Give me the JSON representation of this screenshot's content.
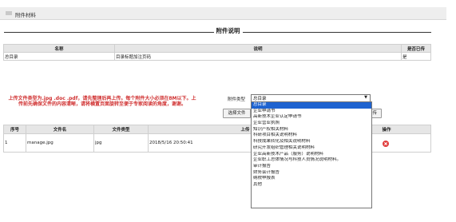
{
  "panel": {
    "title": "附件材料"
  },
  "section_title": "附件说明",
  "table1": {
    "headers": [
      "名称",
      "说明",
      "是否已传"
    ],
    "row": [
      "总目录",
      "目录标题加注页码",
      "是"
    ]
  },
  "notice": "上传文件类型为.jpg .doc .pdf，请先整理后再上传。每个附件大小必须在8M以下。上传前先确保文件的内容清晰，请将横置页面旋转至便于专家阅读的角度，谢谢。",
  "upload": {
    "type_label": "附件类型",
    "selected": "总目录",
    "choose_label": "选择文件",
    "upload_label": "上传"
  },
  "table2": {
    "headers": [
      "序号",
      "文件名",
      "文件类型",
      "上传",
      "操作"
    ],
    "row": [
      "1",
      "manage.jpg",
      "jpg",
      "2018/5/16 20:50:41"
    ]
  },
  "dropdown_options": [
    "总目录",
    "企业申请书",
    "高新技术企业认定申请书",
    "企业营业执照",
    "知识产权相关材料",
    "科研项目相关说明材料",
    "科技成果转化及相关说明材料",
    "研究开发组织管理相关说明材料",
    "企业高新技术产品（服务）说明材料",
    "企业职工总体情况与科技人员情况说明材料。",
    "审计报告",
    "财务会计报告",
    "纳税申报表",
    "其他"
  ],
  "colors": {
    "notice": "#d03030",
    "selected_option": "#1e63d0",
    "arrow_green": "#3aa82b",
    "delete_red": "#e03b3b"
  },
  "icons": [
    "move-down-icon",
    "move-up-icon",
    "delete-icon"
  ]
}
